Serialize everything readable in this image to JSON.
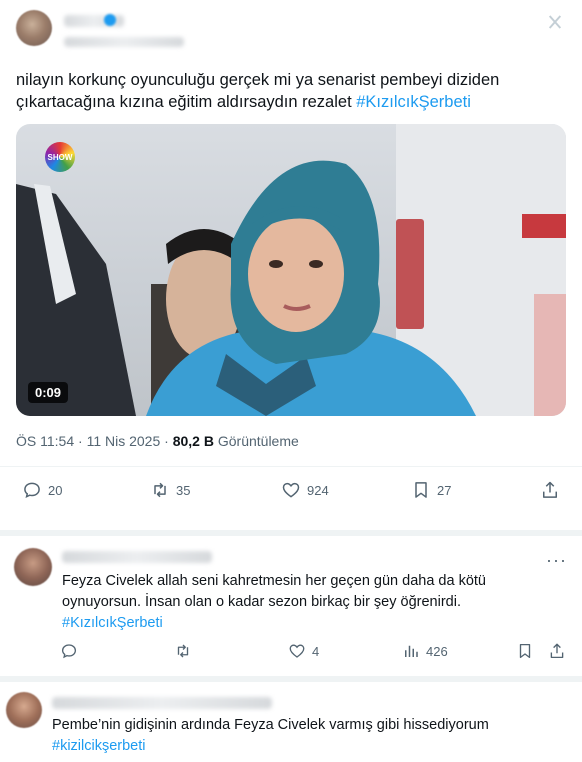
{
  "main_tweet": {
    "text": "nilayın korkunç oyunculuğu gerçek mi ya senarist pembeyi diziden çıkartacağına kızına eğitim aldırsaydın rezalet ",
    "hashtag": "#KızılcıkŞerbeti",
    "video": {
      "channel_logo": "SHOW",
      "duration": "0:09"
    },
    "time": "ÖS 11:54",
    "date": "11 Nis 2025",
    "views_value": "80,2 B",
    "views_label": "Görüntüleme",
    "actions": {
      "replies": "20",
      "retweets": "35",
      "likes": "924",
      "bookmarks": "27"
    }
  },
  "reply_1": {
    "text": "Feyza Civelek allah seni kahretmesin her geçen gün daha da kötü oynuyorsun. İnsan olan o kadar sezon birkaç bir şey öğrenirdi.",
    "hashtag": "#KızılcıkŞerbeti",
    "actions": {
      "likes": "4",
      "views": "426"
    }
  },
  "reply_2": {
    "text": "Pembe’nin gidişinin ardında Feyza Civelek varmış gibi hissediyorum",
    "hashtag": "#kizilcikşerbeti"
  },
  "more_glyph": "···",
  "colors": {
    "accent": "#1d9bf0",
    "text": "#0f1419",
    "muted": "#536471"
  }
}
